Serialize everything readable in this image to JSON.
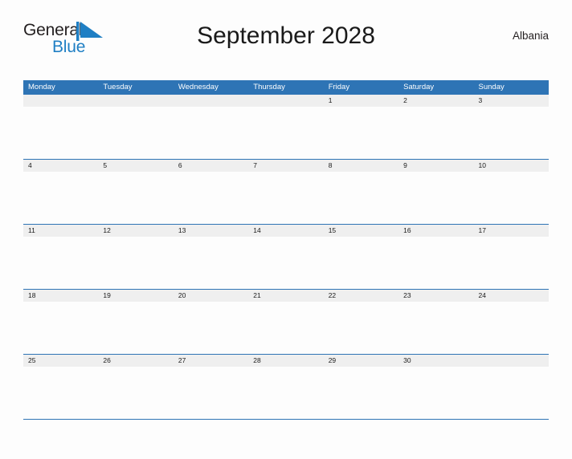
{
  "brand": {
    "name_part1": "General",
    "name_part2": "Blue",
    "flag_icon": "blue-flag-triangle",
    "color_primary": "#1f7fc4",
    "color_dark": "#231f20"
  },
  "header": {
    "title": "September 2028",
    "country": "Albania"
  },
  "calendar": {
    "month": "September",
    "year": "2028",
    "header_color": "#2e74b5",
    "date_band_color": "#efefef",
    "weekday_headers": [
      "Monday",
      "Tuesday",
      "Wednesday",
      "Thursday",
      "Friday",
      "Saturday",
      "Sunday"
    ],
    "weeks": [
      {
        "days": [
          "",
          "",
          "",
          "",
          "1",
          "2",
          "3"
        ]
      },
      {
        "days": [
          "4",
          "5",
          "6",
          "7",
          "8",
          "9",
          "10"
        ]
      },
      {
        "days": [
          "11",
          "12",
          "13",
          "14",
          "15",
          "16",
          "17"
        ]
      },
      {
        "days": [
          "18",
          "19",
          "20",
          "21",
          "22",
          "23",
          "24"
        ]
      },
      {
        "days": [
          "25",
          "26",
          "27",
          "28",
          "29",
          "30",
          ""
        ]
      }
    ]
  }
}
